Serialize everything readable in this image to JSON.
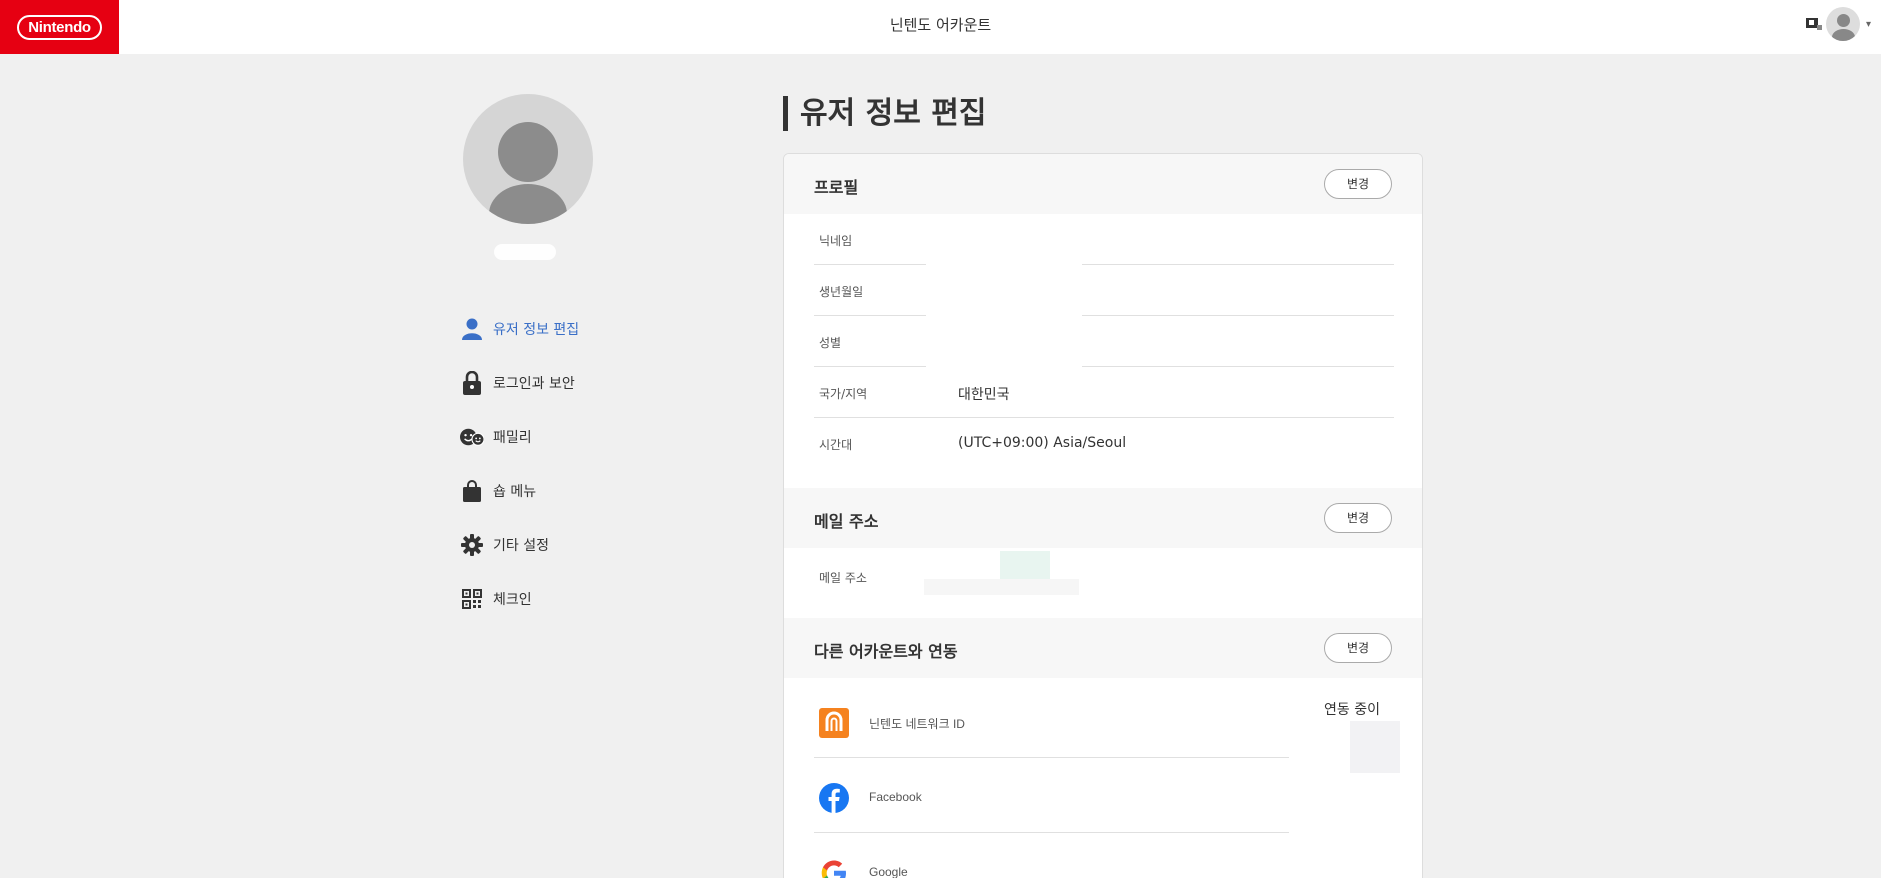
{
  "header": {
    "logo_text": "Nintendo",
    "title": "닌텐도 어카운트",
    "caret": "▾"
  },
  "sidebar": {
    "items": [
      {
        "label": "유저 정보 편집",
        "icon": "user-icon",
        "active": true
      },
      {
        "label": "로그인과 보안",
        "icon": "lock-icon",
        "active": false
      },
      {
        "label": "패밀리",
        "icon": "family-icon",
        "active": false
      },
      {
        "label": "숍 메뉴",
        "icon": "shopping-bag-icon",
        "active": false
      },
      {
        "label": "기타 설정",
        "icon": "gear-icon",
        "active": false
      },
      {
        "label": "체크인",
        "icon": "qr-code-icon",
        "active": false
      }
    ]
  },
  "main": {
    "title": "유저 정보 편집",
    "profile": {
      "heading": "프로필",
      "change_label": "변경",
      "rows": [
        {
          "label": "닉네임",
          "value": ""
        },
        {
          "label": "생년월일",
          "value": ""
        },
        {
          "label": "성별",
          "value": ""
        },
        {
          "label": "국가/지역",
          "value": "대한민국"
        },
        {
          "label": "시간대",
          "value": "(UTC+09:00) Asia/Seoul"
        }
      ]
    },
    "email": {
      "heading": "메일 주소",
      "change_label": "변경",
      "label": "메일 주소"
    },
    "linked": {
      "heading": "다른 어카운트와 연동",
      "change_label": "변경",
      "status": "연동 중이",
      "accounts": [
        {
          "name": "닌텐도 네트워크 ID",
          "icon": "nintendo-network-icon",
          "color": "#f5821f"
        },
        {
          "name": "Facebook",
          "icon": "facebook-icon",
          "color": "#1877f2"
        },
        {
          "name": "Google",
          "icon": "google-icon",
          "color": "#4285f4"
        }
      ]
    }
  },
  "colors": {
    "brand_red": "#e60012",
    "active_blue": "#3a6fc7",
    "background": "#f0f0f0"
  }
}
